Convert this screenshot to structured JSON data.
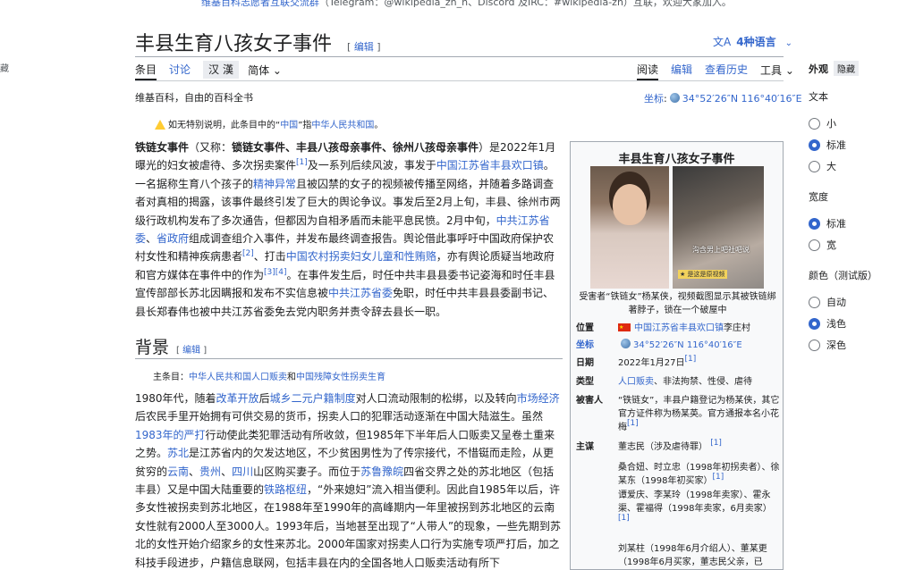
{
  "banner": {
    "text": "维基百科志愿者互联交流群",
    "rest": "（Telegram：@wikipedia_zh_n、Discord 及IRC：#wikipedia-zh）互联，欢迎大家加入。"
  },
  "left_edge": "藏",
  "page": {
    "title": "丰县生育八孩女子事件",
    "edit_label": "编辑",
    "lang_icon": "文A",
    "lang_label": "4种语言",
    "tabs_left": [
      "条目",
      "讨论"
    ],
    "variant": [
      "汉",
      "漢"
    ],
    "variant_dropdown": "简体",
    "tabs_right": [
      "阅读",
      "编辑",
      "查看历史"
    ],
    "tools_label": "工具",
    "tagline": "维基百科，自由的百科全书",
    "coord_label": "坐标",
    "coord_value": "34°52′26″N 116°40′16″E",
    "notice_pre": "如无特别说明，此条目中的“",
    "notice_link1": "中国",
    "notice_mid": "”指",
    "notice_link2": "中华人民共和国",
    "notice_end": "。"
  },
  "lead": {
    "b1": "铁链女事件",
    "p1": "（又称：",
    "b2": "锁链女事件、丰县八孩母亲事件、徐州八孩母亲事件",
    "p2": "）是2022年1月曝光的妇女被虐待、多次拐卖案件",
    "r1": "[1]",
    "p3": "及一系列后续风波，事发于",
    "l1": "中国江苏省丰县欢口镇",
    "p4": "。一名据称生育八个孩子的",
    "l2": "精神异常",
    "p5": "且被囚禁的女子的视频被传播至网络，并随着多路调查者对真相的揭露，该事件最终引发了巨大的舆论争议。事发后至2月上旬，丰县、徐州市两级行政机构发布了多次通告，但都因为自相矛盾而未能平息民愤。2月中旬，",
    "l3": "中共江苏省委",
    "p6": "、",
    "l4": "省政府",
    "p7": "组成调查组介入事件，并发布最终调查报告。舆论借此事呼吁中国政府保护农村女性和精神疾病患者",
    "r2": "[2]",
    "p8": "、打击",
    "l5": "中国农村拐卖妇女儿童和性贿赂",
    "p9": "，亦有舆论质疑当地政府和官方媒体在事件中的作为",
    "r3": "[3][4]",
    "p10": "。在事件发生后，时任中共丰县县委书记姿海和时任丰县宣传部部长苏北因瞒报和发布不实信息被",
    "l6": "中共江苏省委",
    "p11": "免职，时任中共丰县县委副书记、县长郑春伟也被中共江苏省委免去党内职务并责令辞去县长一职。"
  },
  "background": {
    "heading": "背景",
    "hatnote_pre": "主条目：",
    "hatnote_l1": "中华人民共和国人口贩卖",
    "hatnote_mid": "和",
    "hatnote_l2": "中国残障女性拐卖生育",
    "t1": "1980年代，随着",
    "l1": "改革开放",
    "t2": "后",
    "l2": "城乡二元户籍制度",
    "t3": "对人口流动限制的松绑，以及转向",
    "l3": "市场经济",
    "t4": "后农民手里开始拥有可供交易的货币，拐卖人口的犯罪活动逐渐在中国大陆滋生。虽然",
    "l4": "1983年的严打",
    "t5": "行动使此类犯罪活动有所收敛，但1985年下半年后人口贩卖又呈卷土重来之势。",
    "l5": "苏北",
    "t6": "是江苏省内的欠发达地区，不少贫困男性为了传宗接代，不惜铤而走险，从更贫穷的",
    "l6": "云南",
    "t7": "、",
    "l7": "贵州",
    "t8": "、",
    "l8": "四川",
    "t9": "山区购买妻子。而位于",
    "l9": "苏鲁豫皖",
    "t10": "四省交界之处的苏北地区（包括丰县）又是中国大陆重要的",
    "l10": "铁路枢纽",
    "t11": "，“外来媳妇”流入相当便利。因此自1985年以后，许多女性被拐卖到苏北地区，在1988年至1990年的高峰期内一年里被拐到苏北地区的云南女性就有2000人至3000人。1993年后，当地甚至出现了“人带人”的现象，一些先期到苏北的女性开始介绍家乡的女性来苏北。2000年国家对拐卖人口行为实施专项严打后，加之科技手段进步，户籍信息联网，包括丰县在内的全国各地人口贩卖活动有所下"
  },
  "infobox": {
    "title": "丰县生育八孩女子事件",
    "img_caption_text": "沟含男上吧社吧说",
    "img_tag": "★ 是这是原视频",
    "caption": "受害者“铁链女”杨某侠，视频截图显示其被铁链绑著脖子，锁在一个破屋中",
    "rows": [
      {
        "k": "位置",
        "v_link": "中国江苏省丰县欢口镇",
        "v_text": "李庄村"
      },
      {
        "k": "坐标",
        "v_link": "34°52′26″N 116°40′16″E"
      },
      {
        "k": "日期",
        "v_text": "2022年1月27日",
        "ref": "[1]"
      },
      {
        "k": "类型",
        "v_link": "人口贩卖",
        "v_text": "、非法拘禁、性侵、虐待"
      },
      {
        "k": "被害人",
        "v_text": "“铁链女”，丰县户籍登记为杨某侠，其它官方证件称为杨某英。官方通报本名小花梅",
        "ref": "[1]"
      },
      {
        "k": "主谋",
        "v_text": "董志民（涉及虐待罪）",
        "ref": "[1]"
      }
    ],
    "extra1": "桑合妞、时立忠（1998年初拐卖者）、徐某东（1998年初买家）",
    "extra1_ref": "[1]",
    "extra2": "谭爱庆、李某玲（1998年卖家）、霍永渠、霍福得（1998年卖家，6月卖家）",
    "extra2_ref": "[1]",
    "extra3": "刘某柱（1998年6月介绍人）、董某更（1998年6月买家，董志民父亲，已"
  },
  "sidepanel": {
    "title": "外观",
    "hide": "隐藏",
    "text_label": "文本",
    "text_opts": [
      "小",
      "标准",
      "大"
    ],
    "width_label": "宽度",
    "width_opts": [
      "标准",
      "宽"
    ],
    "color_label": "颜色（测试版）",
    "color_opts": [
      "自动",
      "浅色",
      "深色"
    ]
  }
}
